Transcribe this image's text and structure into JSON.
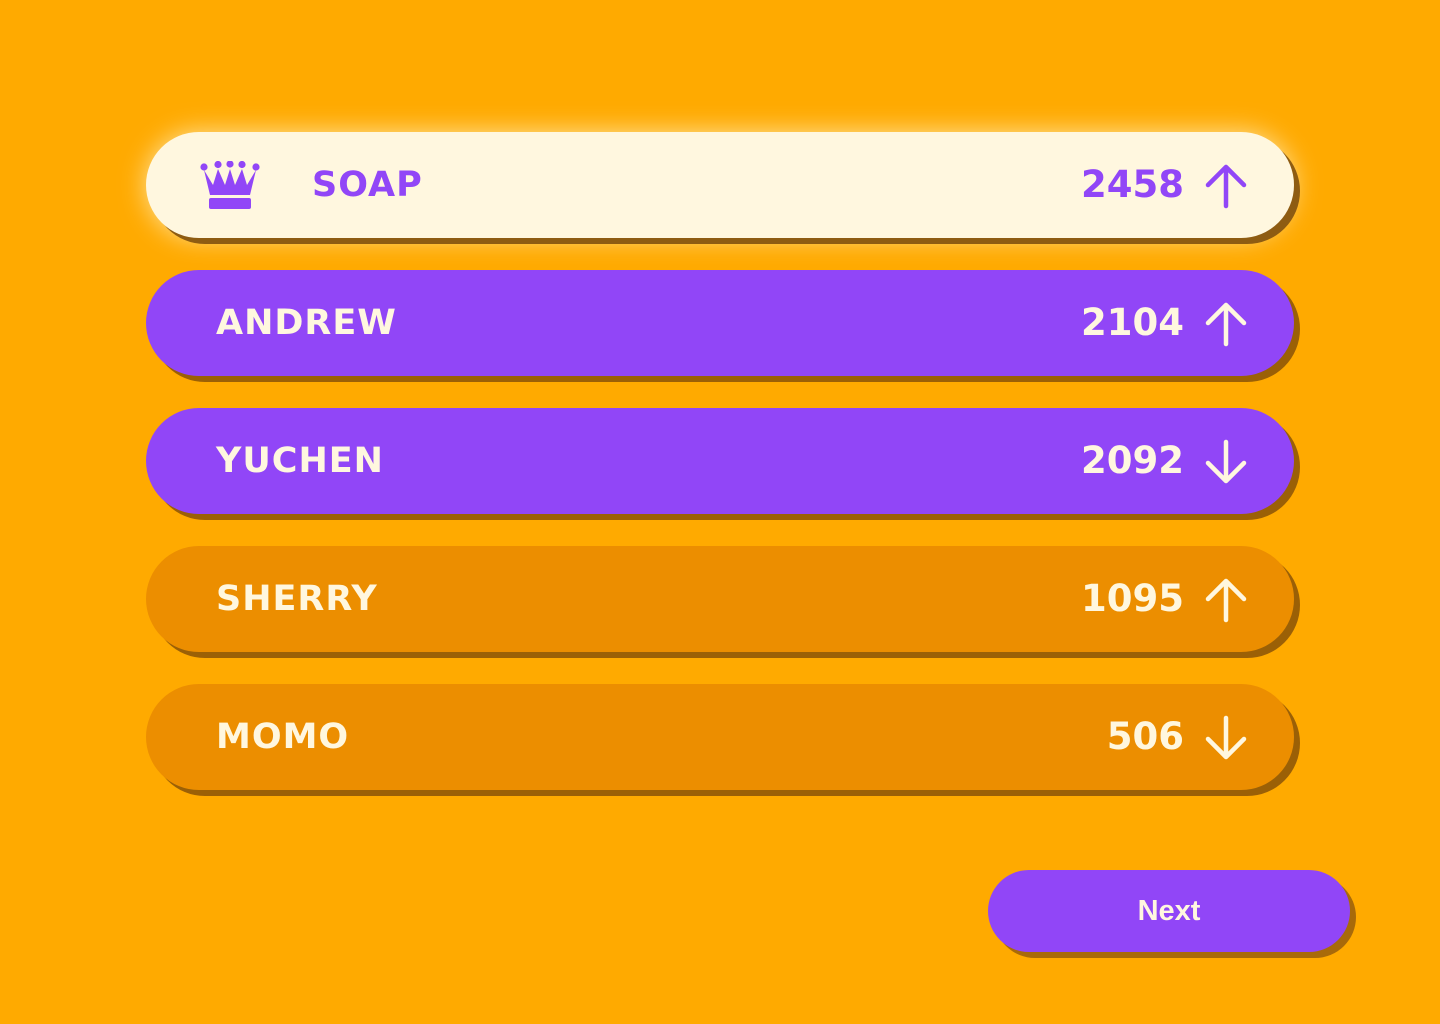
{
  "leaderboard": {
    "entries": [
      {
        "rank": 1,
        "name": "SOAP",
        "score": "2458",
        "trend": "up",
        "trend_icon": "arrow-up-icon",
        "badge_icon": "crown-icon"
      },
      {
        "rank": 2,
        "name": "ANDREW",
        "score": "2104",
        "trend": "up",
        "trend_icon": "arrow-up-icon"
      },
      {
        "rank": 3,
        "name": "YUCHEN",
        "score": "2092",
        "trend": "down",
        "trend_icon": "arrow-down-icon"
      },
      {
        "rank": 4,
        "name": "SHERRY",
        "score": "1095",
        "trend": "up",
        "trend_icon": "arrow-up-icon"
      },
      {
        "rank": 5,
        "name": "MOMO",
        "score": "506",
        "trend": "down",
        "trend_icon": "arrow-down-icon"
      }
    ]
  },
  "actions": {
    "next_label": "Next"
  },
  "colors": {
    "background": "#FFAA00",
    "accent_purple": "#9146F7",
    "cream": "#FFF7DF",
    "dark_orange": "#EC8E00",
    "shadow_brown": "#9B6006"
  }
}
